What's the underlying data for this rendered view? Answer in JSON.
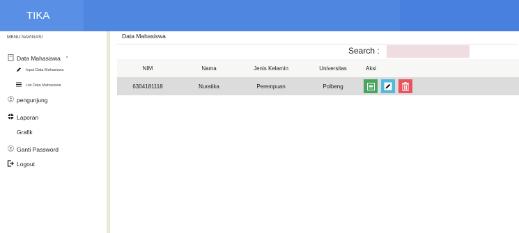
{
  "header": {
    "brand": "TIKA"
  },
  "sidebar": {
    "nav_header": "MENU NAVIGASI",
    "items": [
      {
        "label": "Data Mahasiswa",
        "icon": "document-icon",
        "caret": "^"
      },
      {
        "label": "Input Data Mahasiswa",
        "icon": "pencil-icon"
      },
      {
        "label": "List Data Mahasiswa",
        "icon": "list-icon"
      },
      {
        "label": "pengunjung",
        "icon": "user-icon"
      },
      {
        "label": "Laporan",
        "icon": "dashboard-icon"
      },
      {
        "label": "Grafik",
        "icon": ""
      },
      {
        "label": "Ganti Password",
        "icon": "user-icon"
      },
      {
        "label": "Logout",
        "icon": "logout-icon"
      }
    ]
  },
  "main": {
    "breadcrumb": "Data Mahasiswa",
    "search": {
      "label": "Search :",
      "value": "",
      "placeholder": ""
    },
    "table": {
      "columns": [
        "NIM",
        "Nama",
        "Jenis Kelamin",
        "Universitas",
        "Aksi"
      ],
      "rows": [
        {
          "nim": "6304181118",
          "nama": "Nuratika",
          "jenis_kelamin": "Perempuan",
          "universitas": "Polbeng"
        }
      ]
    },
    "action_colors": {
      "detail": "#48a45f",
      "edit": "#52b9dc",
      "delete": "#e8535d"
    }
  }
}
